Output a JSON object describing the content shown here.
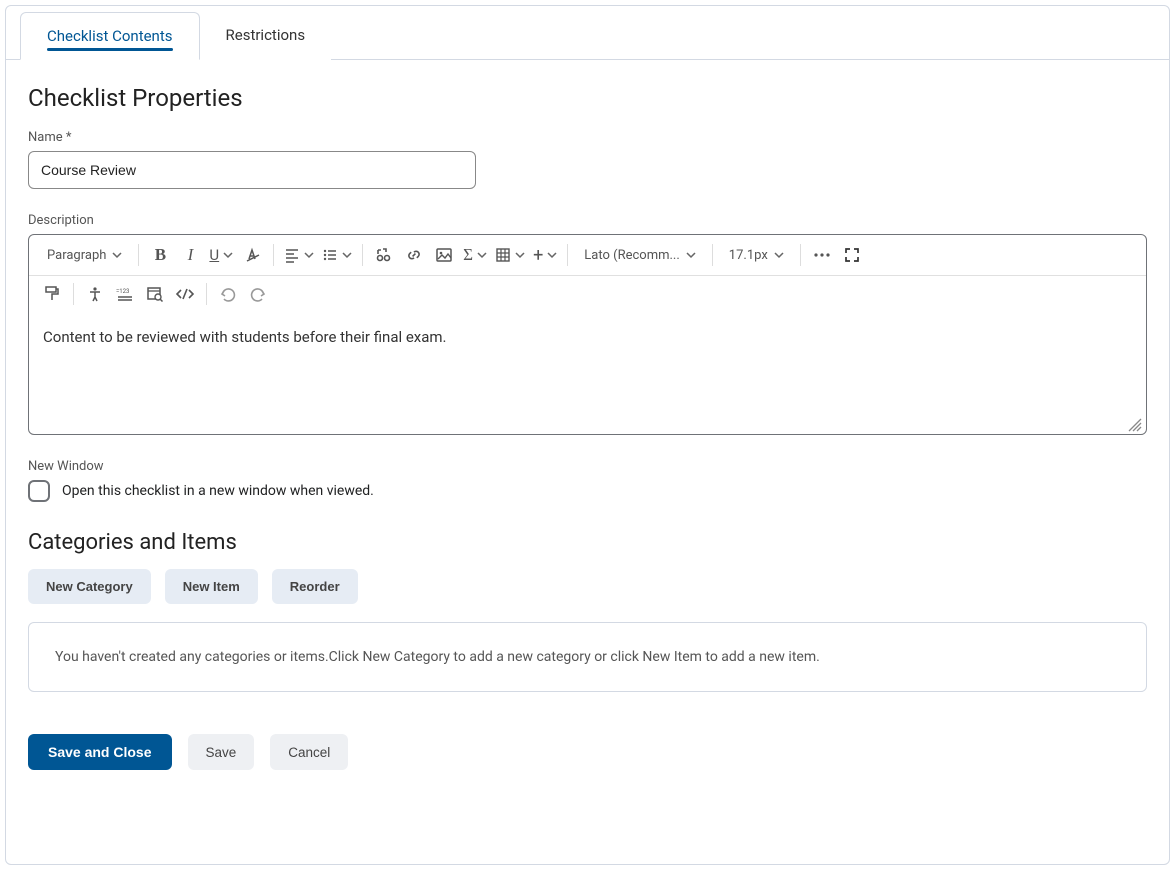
{
  "tabs": {
    "contents": "Checklist Contents",
    "restrictions": "Restrictions"
  },
  "headings": {
    "properties": "Checklist Properties",
    "categories": "Categories and Items"
  },
  "labels": {
    "name": "Name *",
    "description": "Description",
    "new_window": "New Window",
    "open_new_window": "Open this checklist in a new window when viewed."
  },
  "name_value": "Course Review",
  "description_value": "Content to be reviewed with students before their final exam.",
  "toolbar": {
    "paragraph": "Paragraph",
    "font": "Lato (Recomm...",
    "size": "17.1px"
  },
  "buttons": {
    "new_category": "New Category",
    "new_item": "New Item",
    "reorder": "Reorder",
    "save_close": "Save and Close",
    "save": "Save",
    "cancel": "Cancel"
  },
  "empty_msg": "You haven't created any categories or items.Click New Category to add a new category or click New Item to add a new item."
}
